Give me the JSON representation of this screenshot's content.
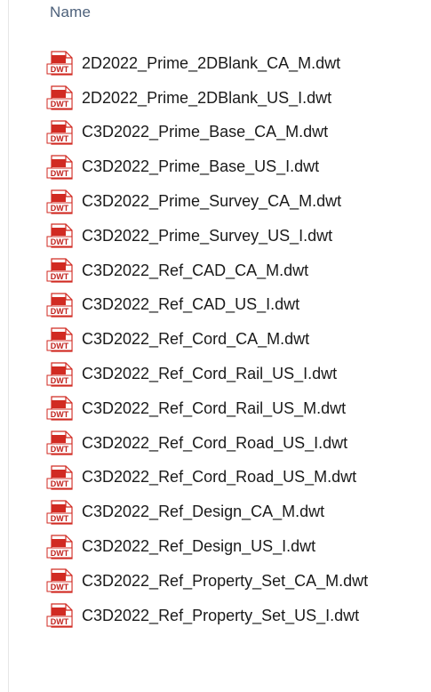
{
  "header": {
    "name_column": "Name"
  },
  "icon": {
    "name": "dwt-file-icon",
    "label": "DWT",
    "accent": "#d12a22",
    "label_color": "#c0201b"
  },
  "files": [
    "2D2022_Prime_2DBlank_CA_M.dwt",
    "2D2022_Prime_2DBlank_US_I.dwt",
    "C3D2022_Prime_Base_CA_M.dwt",
    "C3D2022_Prime_Base_US_I.dwt",
    "C3D2022_Prime_Survey_CA_M.dwt",
    "C3D2022_Prime_Survey_US_I.dwt",
    "C3D2022_Ref_CAD_CA_M.dwt",
    "C3D2022_Ref_CAD_US_I.dwt",
    "C3D2022_Ref_Cord_CA_M.dwt",
    "C3D2022_Ref_Cord_Rail_US_I.dwt",
    "C3D2022_Ref_Cord_Rail_US_M.dwt",
    "C3D2022_Ref_Cord_Road_US_I.dwt",
    "C3D2022_Ref_Cord_Road_US_M.dwt",
    "C3D2022_Ref_Design_CA_M.dwt",
    "C3D2022_Ref_Design_US_I.dwt",
    "C3D2022_Ref_Property_Set_CA_M.dwt",
    "C3D2022_Ref_Property_Set_US_I.dwt"
  ]
}
